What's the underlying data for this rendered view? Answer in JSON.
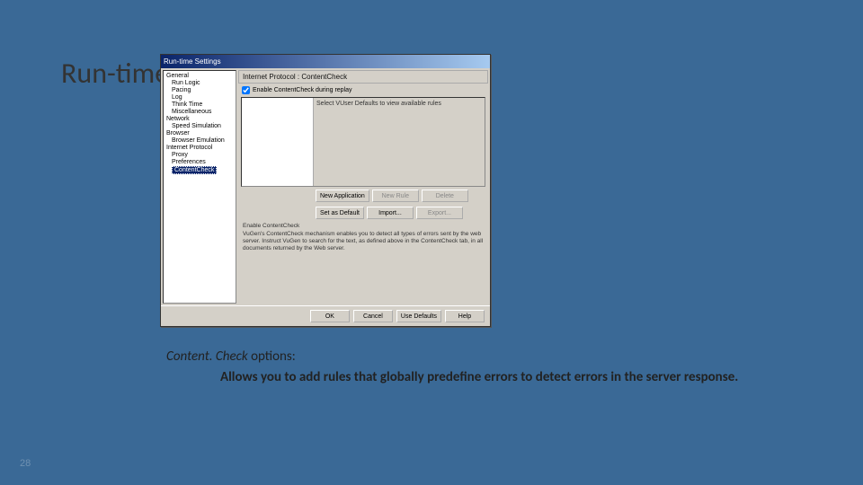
{
  "slide": {
    "title": "Run-time Settings – Content.Check",
    "number": "28"
  },
  "caption": {
    "prefix_italic": "Content. Check",
    "prefix_rest": " options:",
    "desc": " Allows you to add rules that globally predefine errors to detect errors in the server response."
  },
  "dialog": {
    "title": "Run-time Settings",
    "tree": {
      "general": {
        "label": "General",
        "children": [
          "Run Logic",
          "Pacing",
          "Log",
          "Think Time",
          "Miscellaneous"
        ]
      },
      "network": {
        "label": "Network",
        "children": [
          "Speed Simulation"
        ]
      },
      "browser": {
        "label": "Browser",
        "children": [
          "Browser Emulation"
        ]
      },
      "internet": {
        "label": "Internet Protocol",
        "children": [
          "Proxy",
          "Preferences",
          "ContentCheck"
        ]
      },
      "selected": "ContentCheck"
    },
    "pane": {
      "header": "Internet Protocol : ContentCheck",
      "checkbox_label": "Enable ContentCheck during replay",
      "rules_msg": "Select VUser Defaults to view available rules"
    },
    "buttons": {
      "new_app": "New Application",
      "new_rule": "New Rule",
      "delete": "Delete",
      "set_default": "Set as Default",
      "import": "Import...",
      "export": "Export..."
    },
    "hint": {
      "title": "Enable ContentCheck",
      "body": "VuGen's ContentCheck mechanism enables you to detect all types of errors sent by the web server. Instruct VuGen to search for the text, as defined above in the ContentCheck tab, in all documents returned by the Web server."
    },
    "footer": {
      "ok": "OK",
      "cancel": "Cancel",
      "defaults": "Use Defaults",
      "help": "Help"
    }
  }
}
